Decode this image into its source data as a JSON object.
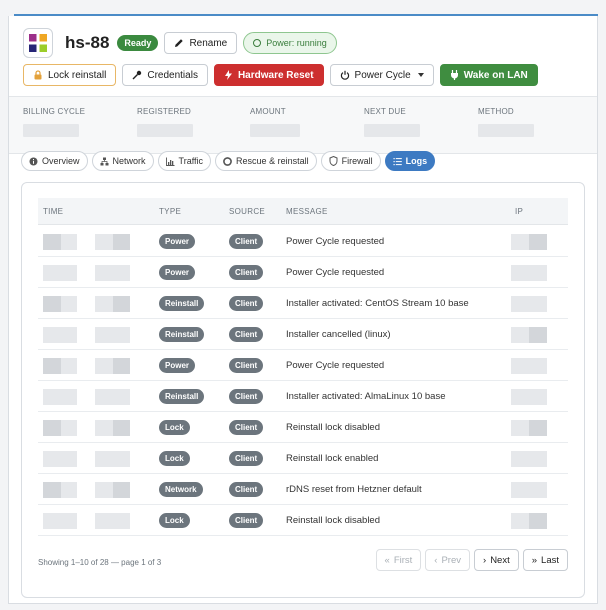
{
  "server": {
    "name": "hs-88",
    "status_badge": "Ready",
    "rename_label": "Rename",
    "power_status": "Power: running",
    "logo": "centos-logo"
  },
  "actions": {
    "lock_reinstall": "Lock reinstall",
    "credentials": "Credentials",
    "hardware_reset": "Hardware Reset",
    "power_cycle": "Power Cycle",
    "wake_on_lan": "Wake on LAN"
  },
  "billing": {
    "cycle_label": "BILLING CYCLE",
    "registered_label": "REGISTERED",
    "amount_label": "AMOUNT",
    "next_due_label": "NEXT DUE",
    "method_label": "METHOD"
  },
  "tabs": [
    {
      "label": "Overview",
      "icon": "info-icon"
    },
    {
      "label": "Network",
      "icon": "network-icon"
    },
    {
      "label": "Traffic",
      "icon": "chart-icon"
    },
    {
      "label": "Rescue & reinstall",
      "icon": "lifebuoy-icon"
    },
    {
      "label": "Firewall",
      "icon": "shield-icon"
    },
    {
      "label": "Logs",
      "icon": "list-icon",
      "active": true
    }
  ],
  "logs": {
    "columns": [
      "TIME",
      "TYPE",
      "SOURCE",
      "MESSAGE",
      "IP"
    ],
    "rows": [
      {
        "type": "Power",
        "source": "Client",
        "message": "Power Cycle requested"
      },
      {
        "type": "Power",
        "source": "Client",
        "message": "Power Cycle requested"
      },
      {
        "type": "Reinstall",
        "source": "Client",
        "message": "Installer activated: CentOS Stream 10 base"
      },
      {
        "type": "Reinstall",
        "source": "Client",
        "message": "Installer cancelled (linux)"
      },
      {
        "type": "Power",
        "source": "Client",
        "message": "Power Cycle requested"
      },
      {
        "type": "Reinstall",
        "source": "Client",
        "message": "Installer activated: AlmaLinux 10 base"
      },
      {
        "type": "Lock",
        "source": "Client",
        "message": "Reinstall lock disabled"
      },
      {
        "type": "Lock",
        "source": "Client",
        "message": "Reinstall lock enabled"
      },
      {
        "type": "Network",
        "source": "Client",
        "message": "rDNS reset from Hetzner default"
      },
      {
        "type": "Lock",
        "source": "Client",
        "message": "Reinstall lock disabled"
      }
    ],
    "footer": "Showing 1–10 of 28 — page 1 of 3",
    "pager": {
      "first": "First",
      "prev": "Prev",
      "next": "Next",
      "last": "Last"
    }
  },
  "colors": {
    "accent": "#3d7ac2",
    "danger": "#cd2f2f",
    "success": "#3f8d40",
    "pill": "#6c757d"
  }
}
